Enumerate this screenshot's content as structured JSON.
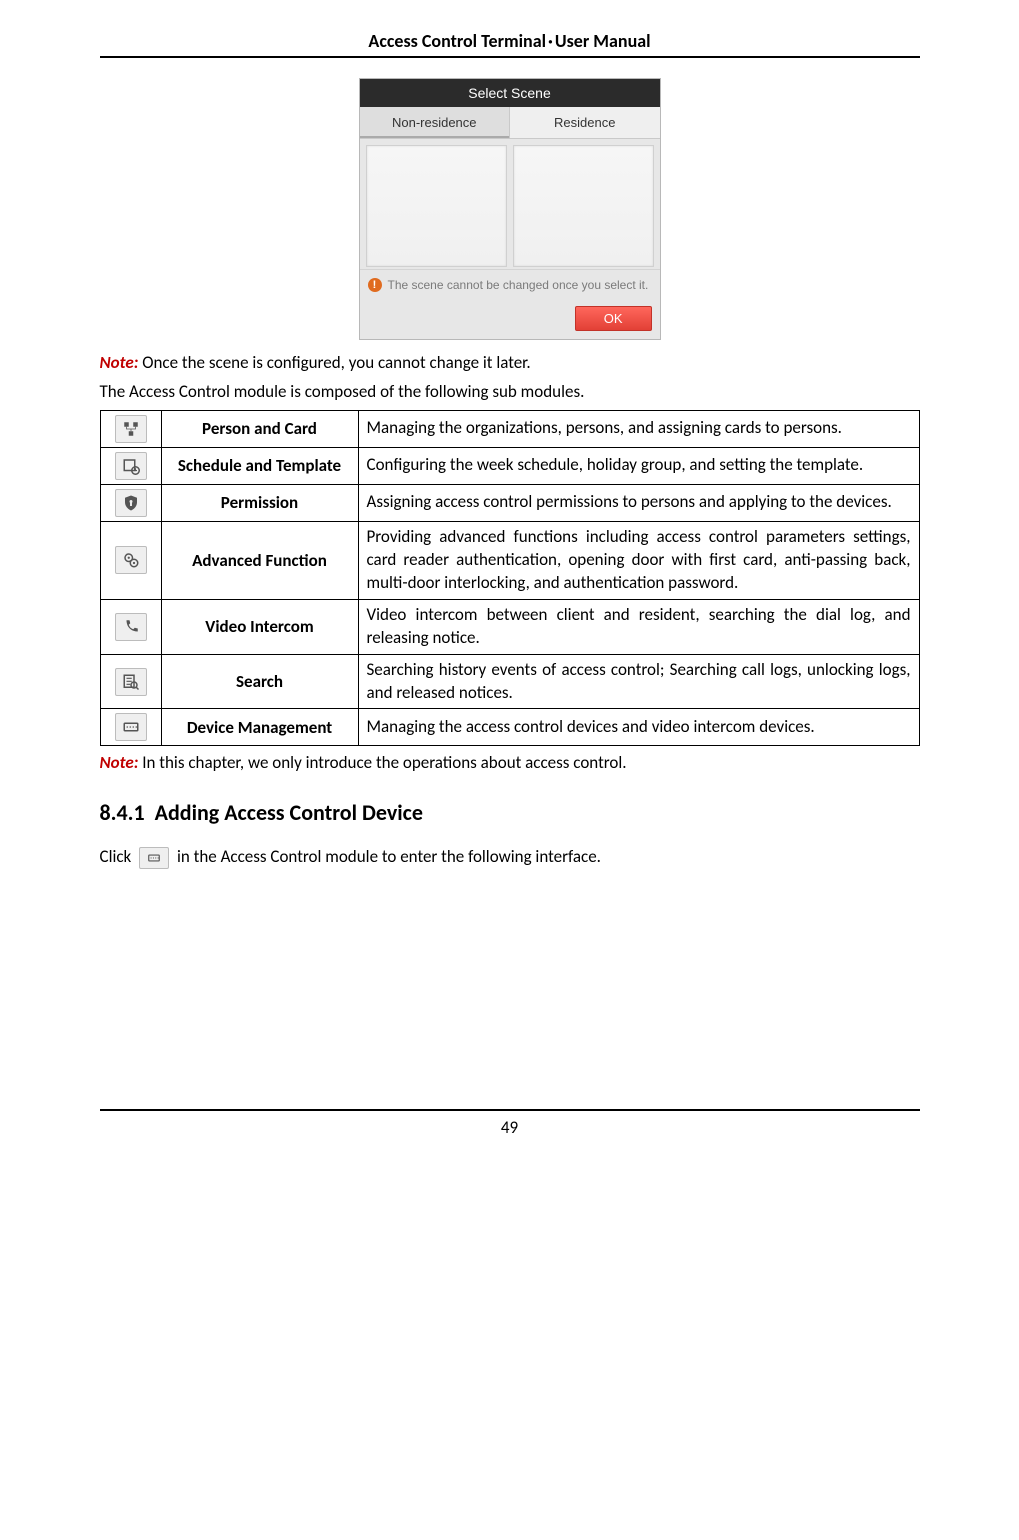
{
  "header": {
    "left": "Access Control Terminal",
    "sep": "·",
    "right": "User Manual"
  },
  "dialog": {
    "title": "Select Scene",
    "tabs": [
      "Non-residence",
      "Residence"
    ],
    "active_tab_index": 0,
    "message": "The scene cannot be changed once you select it.",
    "ok": "OK"
  },
  "note1_label": "Note:",
  "note1_text": " Once the scene is configured, you cannot change it later.",
  "intro": "The Access Control module is composed of the following sub modules.",
  "modules": [
    {
      "name": "Person and Card",
      "desc": "Managing the organizations, persons, and assigning cards to persons."
    },
    {
      "name": "Schedule and Template",
      "desc": "Configuring the week schedule, holiday group, and setting the template."
    },
    {
      "name": "Permission",
      "desc": "Assigning access control permissions to persons and applying to the devices."
    },
    {
      "name": "Advanced Function",
      "desc": "Providing advanced functions including access control parameters settings, card reader authentication, opening door with first card, anti-passing back, multi-door interlocking, and authentication password."
    },
    {
      "name": "Video Intercom",
      "desc": "Video intercom between client and resident, searching the dial log, and releasing notice."
    },
    {
      "name": "Search",
      "desc": "Searching history events of access control; Searching call logs, unlocking logs, and released notices."
    },
    {
      "name": "Device Management",
      "desc": "Managing the access control devices and video intercom devices."
    }
  ],
  "note2_label": "Note:",
  "note2_text": " In this chapter, we only introduce the operations about access control.",
  "section": {
    "number": "8.4.1",
    "title": "Adding Access Control Device"
  },
  "click_line": {
    "pre": "Click ",
    "post": " in the Access Control module to enter the following interface."
  },
  "page_number": "49"
}
